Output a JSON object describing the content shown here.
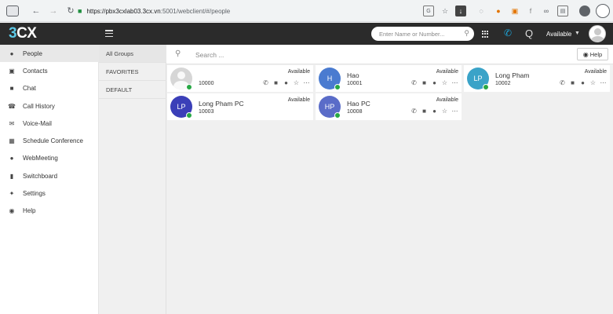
{
  "browser": {
    "url_host": "https://pbx3cxlab03.3cx.vn",
    "url_path": ":5001/webclient/#/people"
  },
  "header": {
    "logo_prefix": "3",
    "logo_suffix": "CX",
    "search_placeholder": "Enter Name or Number...",
    "status": "Available"
  },
  "sidebar": {
    "items": [
      {
        "label": "People",
        "icon": "person-icon",
        "active": true
      },
      {
        "label": "Contacts",
        "icon": "contact-book-icon"
      },
      {
        "label": "Chat",
        "icon": "chat-bubble-icon"
      },
      {
        "label": "Call History",
        "icon": "phone-history-icon"
      },
      {
        "label": "Voice-Mail",
        "icon": "envelope-icon"
      },
      {
        "label": "Schedule Conference",
        "icon": "calendar-icon"
      },
      {
        "label": "WebMeeting",
        "icon": "group-icon"
      },
      {
        "label": "Switchboard",
        "icon": "bar-chart-icon"
      },
      {
        "label": "Settings",
        "icon": "wrench-icon"
      },
      {
        "label": "Help",
        "icon": "lifebuoy-icon"
      }
    ]
  },
  "groups": {
    "items": [
      "All Groups",
      "FAVORITES",
      "DEFAULT"
    ]
  },
  "people": {
    "search_placeholder": "Search ...",
    "help_label": "Help",
    "cards": [
      {
        "name": "",
        "ext": "10000",
        "status": "Available",
        "initials": "",
        "color": "#d6d6d6"
      },
      {
        "name": "Hao",
        "ext": "10001",
        "status": "Available",
        "initials": "H",
        "color": "#4a7bd0"
      },
      {
        "name": "Long Pham",
        "ext": "10002",
        "status": "Available",
        "initials": "LP",
        "color": "#3aa3c8"
      },
      {
        "name": "Long Pham PC",
        "ext": "10003",
        "status": "Available",
        "initials": "LP",
        "color": "#3b3fb8"
      },
      {
        "name": "Hao PC",
        "ext": "10008",
        "status": "Available",
        "initials": "HP",
        "color": "#5a6cc8"
      }
    ]
  },
  "colors": {
    "header_bg": "#2b2b2b",
    "accent": "#1ea4d8",
    "online": "#27a844"
  }
}
